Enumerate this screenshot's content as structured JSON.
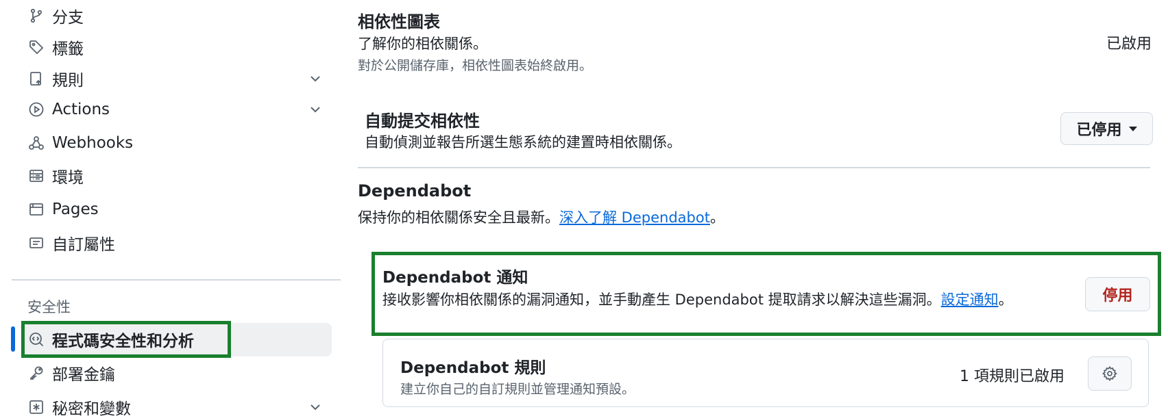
{
  "sidebar": {
    "items": [
      {
        "label": "分支",
        "icon": "branch-icon"
      },
      {
        "label": "標籤",
        "icon": "tag-icon"
      },
      {
        "label": "規則",
        "icon": "rules-icon",
        "expandable": true
      },
      {
        "label": "Actions",
        "icon": "play-icon",
        "expandable": true
      },
      {
        "label": "Webhooks",
        "icon": "webhook-icon"
      },
      {
        "label": "環境",
        "icon": "environment-icon"
      },
      {
        "label": "Pages",
        "icon": "browser-icon"
      },
      {
        "label": "自訂屬性",
        "icon": "note-icon"
      }
    ],
    "section_label": "安全性",
    "security_items": [
      {
        "label": "程式碼安全性和分析",
        "icon": "codescan-icon",
        "active": true
      },
      {
        "label": "部署金鑰",
        "icon": "key-icon"
      },
      {
        "label": "秘密和變數",
        "icon": "asterisk-icon",
        "expandable": true
      }
    ]
  },
  "main": {
    "dependency_graph": {
      "title": "相依性圖表",
      "description": "了解你的相依關係。",
      "note": "對於公開儲存庫，相依性圖表始終啟用。",
      "status": "已啟用"
    },
    "auto_submission": {
      "title": "自動提交相依性",
      "description": "自動偵測並報告所選生態系統的建置時相依關係。",
      "dropdown_value": "已停用"
    },
    "dependabot": {
      "title": "Dependabot",
      "description_prefix": "保持你的相依關係安全且最新。",
      "link_text": "深入了解 Dependabot",
      "description_suffix": "。"
    },
    "dependabot_alerts": {
      "title": "Dependabot 通知",
      "description_prefix": "接收影響你相依關係的漏洞通知，並手動產生 Dependabot 提取請求以解決這些漏洞。",
      "link_text": "設定通知",
      "description_suffix": "。",
      "button_label": "停用"
    },
    "dependabot_rules": {
      "title": "Dependabot 規則",
      "description": "建立你自己的自訂規則並管理通知預設。",
      "status": "1 項規則已啟用"
    }
  },
  "colors": {
    "highlight": "#1a7f2e",
    "link": "#0969da",
    "danger": "#b3261e",
    "active_indicator": "#0969da"
  }
}
